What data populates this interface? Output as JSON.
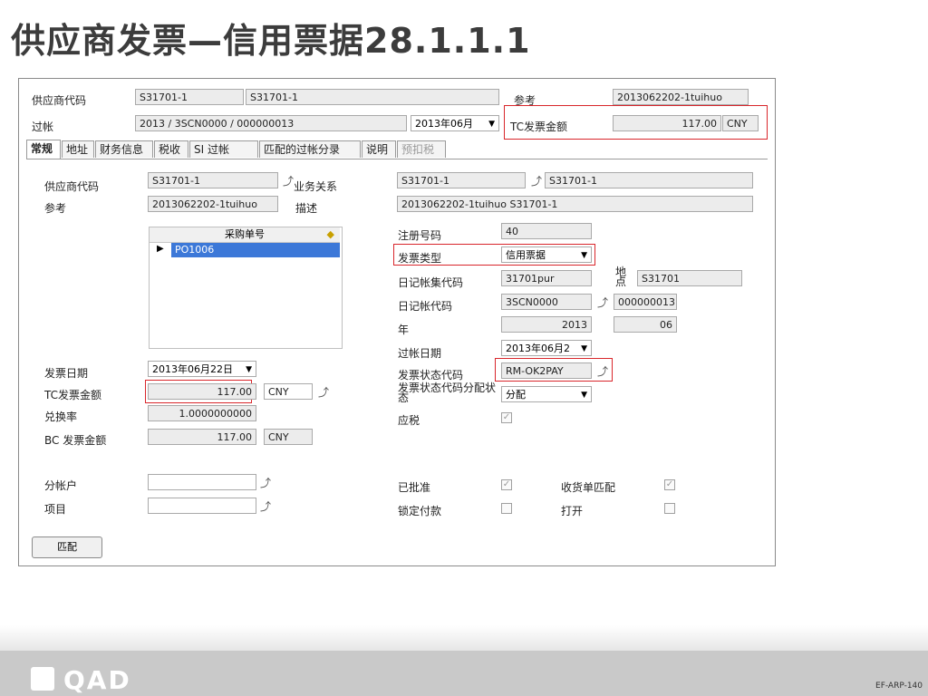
{
  "slide": {
    "title": "供应商发票—信用票据28.1.1.1",
    "code": "EF-ARP-140",
    "logo": "QAD"
  },
  "header": {
    "supplier_code_label": "供应商代码",
    "supplier_code": "S31701-1",
    "supplier_name": "S31701-1",
    "ref_label": "参考",
    "ref": "2013062202-1tuihuo",
    "posting_label": "过帐",
    "posting": "2013 / 3SCN0000 / 000000013",
    "posting_period": "2013年06月",
    "tc_amount_label": "TC发票金额",
    "tc_amount": "117.00",
    "currency": "CNY"
  },
  "tabs": [
    "常规",
    "地址",
    "财务信息",
    "税收",
    "SI 过帐",
    "匹配的过帐分录",
    "说明",
    "预扣税"
  ],
  "general": {
    "supplier_code_label": "供应商代码",
    "supplier_code": "S31701-1",
    "business_relation_label": "业务关系",
    "business_relation": "S31701-1",
    "business_relation_name": "S31701-1",
    "ref_label": "参考",
    "ref": "2013062202-1tuihuo",
    "desc_label": "描述",
    "desc": "2013062202-1tuihuo S31701-1",
    "po_header": "采购单号",
    "po_row": "PO1006",
    "reg_no_label": "注册号码",
    "reg_no": "40",
    "invoice_type_label": "发票类型",
    "invoice_type": "信用票据",
    "daybook_set_label": "日记帐集代码",
    "daybook_set": "31701pur",
    "site_label": "地点",
    "site": "S31701",
    "daybook_label": "日记帐代码",
    "daybook": "3SCN0000",
    "daybook_no": "000000013",
    "year_label": "年",
    "year": "2013",
    "period": "06",
    "posting_date_label": "过帐日期",
    "posting_date": "2013年06月2",
    "invoice_date_label": "发票日期",
    "invoice_date": "2013年06月22日",
    "status_label": "发票状态代码",
    "status": "RM-OK2PAY",
    "tc_amount_label": "TC发票金额",
    "tc_amount": "117.00",
    "tc_currency": "CNY",
    "status_alloc_label": "发票状态代码分配状态",
    "status_alloc": "分配",
    "exchange_label": "兑换率",
    "exchange": "1.0000000000",
    "taxable_label": "应税",
    "bc_amount_label": "BC 发票金额",
    "bc_amount": "117.00",
    "bc_currency": "CNY",
    "sub_account_label": "分帐户",
    "project_label": "项目",
    "approved_label": "已批准",
    "receipt_match_label": "收货单匹配",
    "lock_payment_label": "锁定付款",
    "open_label": "打开",
    "match_button": "匹配"
  }
}
